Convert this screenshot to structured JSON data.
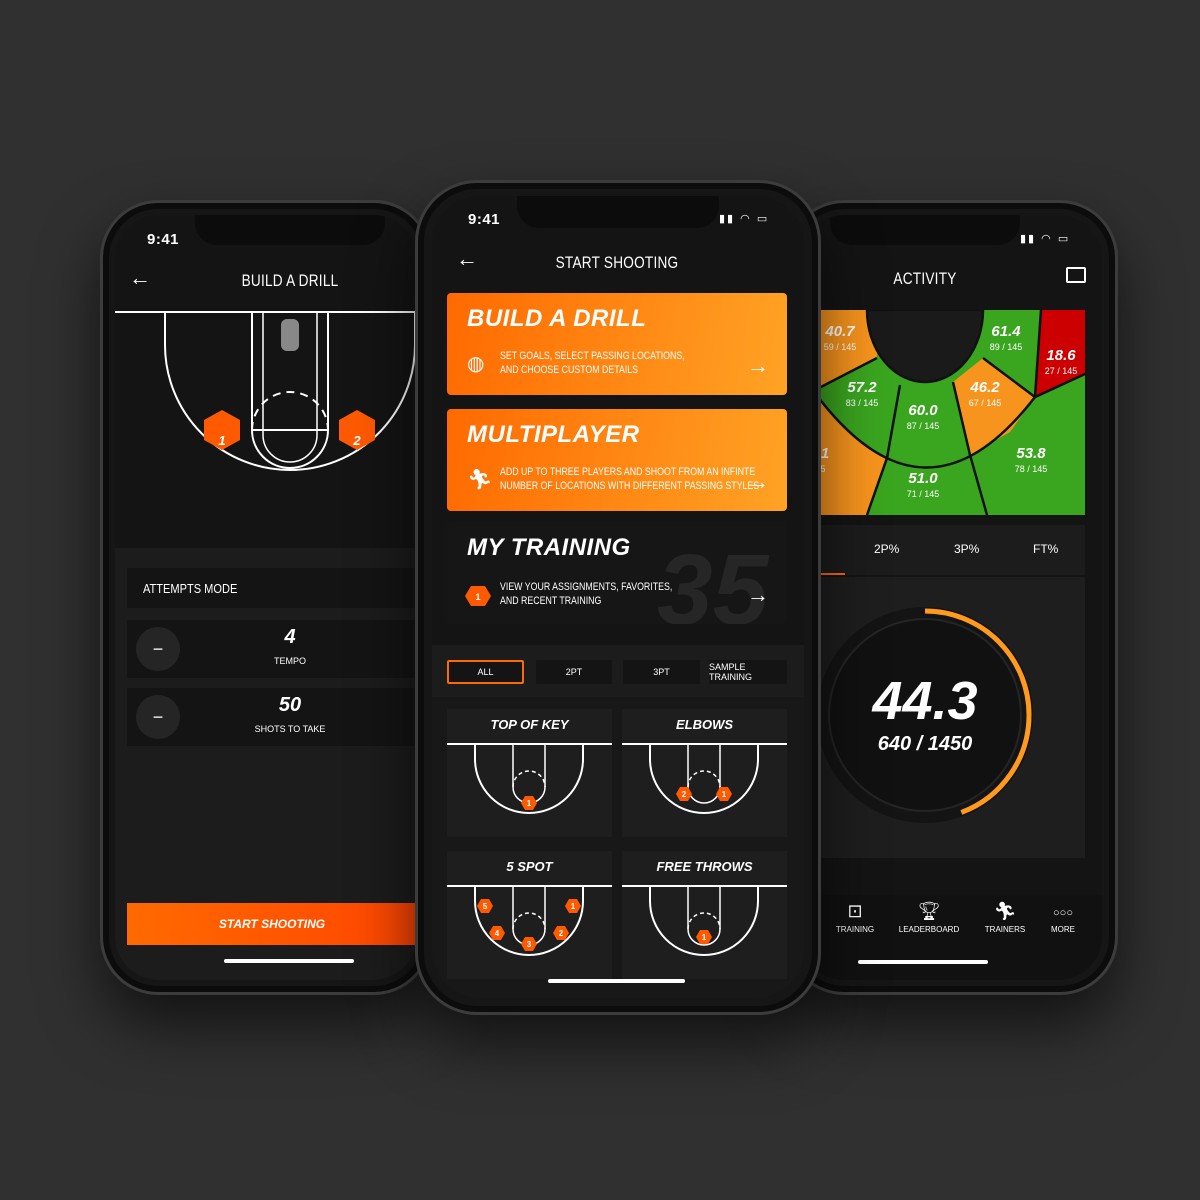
{
  "colors": {
    "accent": "#ff6a00",
    "accent_light": "#ffa325",
    "green": "#3aa51f",
    "orange": "#f7941d",
    "red": "#cc0000",
    "bg": "#141414"
  },
  "status": {
    "time": "9:41"
  },
  "left": {
    "title": "BUILD A DRILL",
    "court_spots": [
      "1",
      "2"
    ],
    "attempts_mode": "ATTEMPTS MODE",
    "tempo": {
      "value": "4",
      "label": "TEMPO",
      "minus": "−"
    },
    "shots": {
      "value": "50",
      "label": "SHOTS TO TAKE",
      "minus": "−"
    },
    "start_button": "START SHOOTING"
  },
  "middle": {
    "title": "START SHOOTING",
    "cards": [
      {
        "title": "BUILD A DRILL",
        "desc1": "SET GOALS, SELECT PASSING LOCATIONS,",
        "desc2": "AND CHOOSE CUSTOM DETAILS",
        "icon": "basketball-icon"
      },
      {
        "title": "MULTIPLAYER",
        "desc1": "ADD UP TO THREE PLAYERS AND SHOOT FROM AN INFINTE",
        "desc2": "NUMBER OF LOCATIONS WITH DIFFERENT PASSING STYLES",
        "icon": "runner-icon"
      },
      {
        "title": "MY TRAINING",
        "desc1": "VIEW YOUR ASSIGNMENTS, FAVORITES,",
        "desc2": "AND RECENT TRAINING",
        "badge": "1",
        "bg_number": "35"
      }
    ],
    "filters": [
      "ALL",
      "2PT",
      "3PT",
      "SAMPLE TRAINING"
    ],
    "active_filter": "ALL",
    "drills": [
      {
        "title": "TOP OF KEY",
        "spots": [
          "1"
        ]
      },
      {
        "title": "ELBOWS",
        "spots": [
          "2",
          "1"
        ]
      },
      {
        "title": "5 SPOT",
        "spots": [
          "5",
          "1",
          "4",
          "2",
          "3"
        ]
      },
      {
        "title": "FREE THROWS",
        "spots": [
          "1"
        ]
      }
    ]
  },
  "right": {
    "title": "ACTIVITY",
    "zones": [
      {
        "pct": "40.7",
        "made": "59 / 145",
        "level": "orange"
      },
      {
        "pct": "1",
        "made": "5",
        "level": "orange"
      },
      {
        "pct": "57.2",
        "made": "83 / 145",
        "level": "green"
      },
      {
        "pct": "60.0",
        "made": "87 / 145",
        "level": "green"
      },
      {
        "pct": "46.2",
        "made": "67 / 145",
        "level": "orange"
      },
      {
        "pct": "61.4",
        "made": "89 / 145",
        "level": "green"
      },
      {
        "pct": "18.6",
        "made": "27 / 145",
        "level": "red"
      },
      {
        "pct": "51.0",
        "made": "71 / 145",
        "level": "green"
      },
      {
        "pct": "53.8",
        "made": "78 / 145",
        "level": "green"
      }
    ],
    "tabs": [
      "2P%",
      "3P%",
      "FT%"
    ],
    "overall": {
      "pct": "44.3",
      "made": "640 / 1450",
      "progress": 0.443
    },
    "nav": [
      {
        "label": "TRAINING",
        "icon": "hoop-icon"
      },
      {
        "label": "LEADERBOARD",
        "icon": "trophy-icon"
      },
      {
        "label": "TRAINERS",
        "icon": "runner-icon"
      },
      {
        "label": "MORE",
        "icon": "more-icon"
      }
    ]
  }
}
